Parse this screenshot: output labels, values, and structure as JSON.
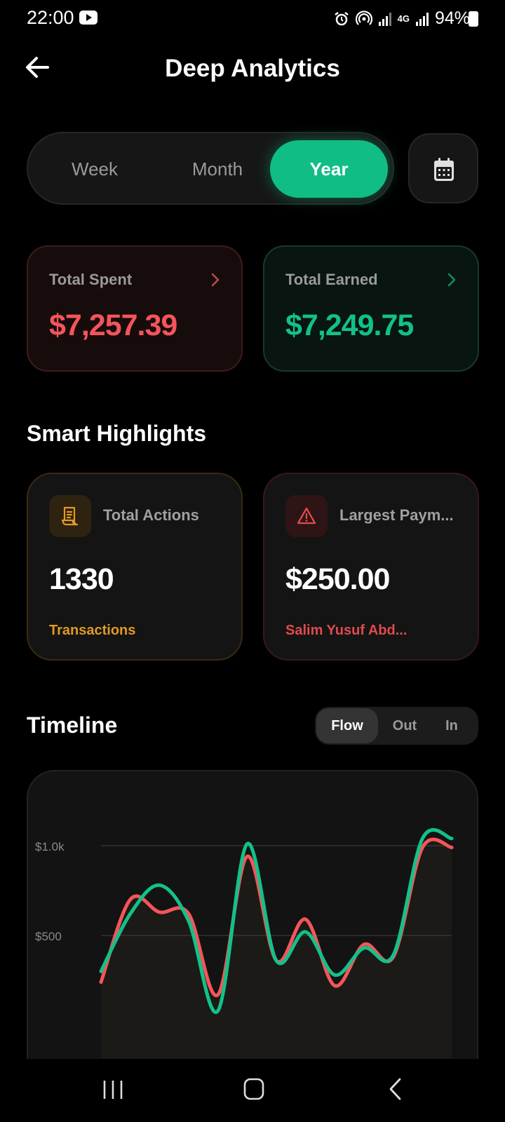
{
  "status": {
    "time": "22:00",
    "battery": "94%",
    "network": "4G"
  },
  "header": {
    "title": "Deep Analytics"
  },
  "period_tabs": [
    {
      "label": "Week",
      "selected": false
    },
    {
      "label": "Month",
      "selected": false
    },
    {
      "label": "Year",
      "selected": true
    }
  ],
  "summary": {
    "spent": {
      "label": "Total Spent",
      "value": "$7,257.39"
    },
    "earned": {
      "label": "Total Earned",
      "value": "$7,249.75"
    }
  },
  "highlights": {
    "title": "Smart Highlights",
    "actions": {
      "label": "Total Actions",
      "value": "1330",
      "sub": "Transactions",
      "icon": "receipt-icon"
    },
    "largest": {
      "label": "Largest Paym...",
      "value": "$250.00",
      "sub": "Salim Yusuf Abd...",
      "icon": "warning-icon"
    }
  },
  "timeline": {
    "title": "Timeline",
    "filters": [
      {
        "label": "Flow",
        "selected": true
      },
      {
        "label": "Out",
        "selected": false
      },
      {
        "label": "In",
        "selected": false
      }
    ]
  },
  "colors": {
    "accent": "#10bd85",
    "spent": "#f4555a",
    "earned": "#12c18a",
    "warning": "#e19a22"
  },
  "chart_data": {
    "type": "line",
    "y_tick_labels": [
      "$1.0k",
      "$500"
    ],
    "y_ticks": [
      1000,
      500
    ],
    "ylim": [
      0,
      1000
    ],
    "grid": true,
    "legend": "none",
    "x": [
      0,
      1,
      2,
      3,
      4,
      5,
      6,
      7,
      8,
      9,
      10,
      11,
      12
    ],
    "series": [
      {
        "color": "#f4555a",
        "values": [
          240,
          700,
          630,
          620,
          170,
          940,
          360,
          590,
          220,
          450,
          380,
          990,
          990
        ]
      },
      {
        "color": "#12c18a",
        "values": [
          300,
          620,
          780,
          580,
          80,
          1010,
          360,
          520,
          280,
          430,
          390,
          1040,
          1040
        ]
      }
    ]
  }
}
